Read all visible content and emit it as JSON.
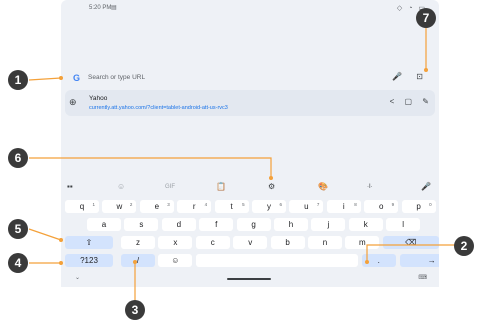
{
  "status": {
    "time": "5:20 PM",
    "notif": "▤",
    "icons": "◇ ◔ ▭"
  },
  "omnibox": {
    "placeholder": "Search or type URL",
    "g": "G",
    "mic": "🎤",
    "lens": "⊡"
  },
  "suggestion": {
    "title": "Yahoo",
    "url": "currently.att.yahoo.com/?client=tablet-android-att-us-rvc3",
    "share": "<",
    "copy": "▢",
    "edit": "✎"
  },
  "toolbar": {
    "apps": "▪▪",
    "sticker": "☺",
    "gif": "GIF",
    "clipboard": "📋",
    "settings": "⚙",
    "palette": "🎨",
    "cursor": "·I·",
    "mic": "🎤"
  },
  "keyboard": {
    "row1": [
      {
        "k": "q",
        "s": "1"
      },
      {
        "k": "w",
        "s": "2"
      },
      {
        "k": "e",
        "s": "3"
      },
      {
        "k": "r",
        "s": "4"
      },
      {
        "k": "t",
        "s": "5"
      },
      {
        "k": "y",
        "s": "6"
      },
      {
        "k": "u",
        "s": "7"
      },
      {
        "k": "i",
        "s": "8"
      },
      {
        "k": "o",
        "s": "9"
      },
      {
        "k": "p",
        "s": "0"
      }
    ],
    "row2": [
      "a",
      "s",
      "d",
      "f",
      "g",
      "h",
      "j",
      "k",
      "l"
    ],
    "row3": {
      "shift": "⇧",
      "letters": [
        "z",
        "x",
        "c",
        "v",
        "b",
        "n",
        "m"
      ],
      "backspace": "⌫"
    },
    "row4": {
      "symbols": "?123",
      "slash": "/",
      "emoji": "☺",
      "space": "",
      "period": ".",
      "enter": "→"
    }
  },
  "navbar": {
    "chevron": "⌄",
    "kb": "⌨"
  },
  "callouts": [
    "1",
    "2",
    "3",
    "4",
    "5",
    "6",
    "7"
  ]
}
